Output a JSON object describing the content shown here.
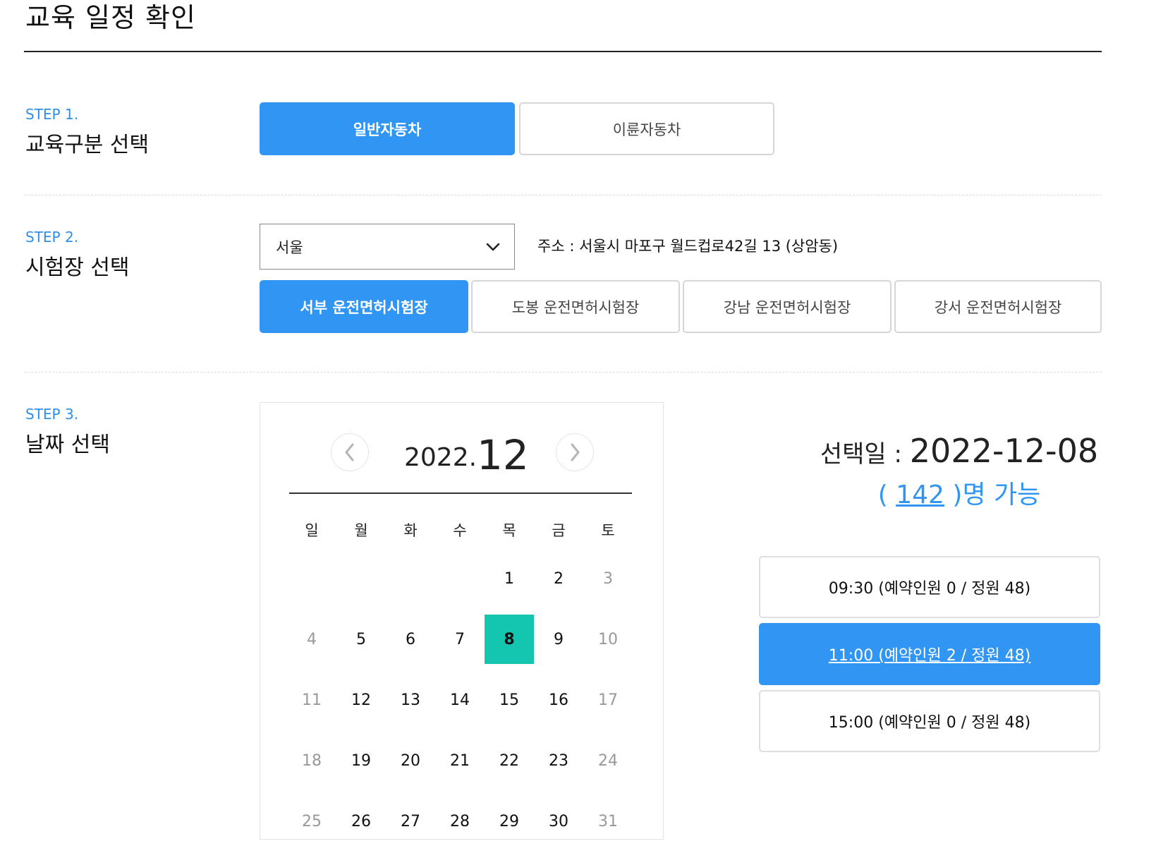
{
  "page": {
    "title": "교육 일정 확인"
  },
  "step1": {
    "label": "STEP 1.",
    "title": "교육구분 선택",
    "options": [
      "일반자동차",
      "이륜자동차"
    ],
    "selected_index": 0
  },
  "step2": {
    "label": "STEP 2.",
    "title": "시험장 선택",
    "region_select": {
      "value": "서울"
    },
    "address": "주소 : 서울시 마포구 월드컵로42길 13 (상암동)",
    "centers": [
      "서부 운전면허시험장",
      "도봉 운전면허시험장",
      "강남 운전면허시험장",
      "강서 운전면허시험장"
    ],
    "selected_index": 0
  },
  "step3": {
    "label": "STEP 3.",
    "title": "날짜 선택",
    "calendar": {
      "year": "2022.",
      "month": "12",
      "weekdays": [
        "일",
        "월",
        "화",
        "수",
        "목",
        "금",
        "토"
      ],
      "weeks": [
        [
          "",
          "",
          "",
          "",
          "1",
          "2",
          "3"
        ],
        [
          "4",
          "5",
          "6",
          "7",
          "8",
          "9",
          "10"
        ],
        [
          "11",
          "12",
          "13",
          "14",
          "15",
          "16",
          "17"
        ],
        [
          "18",
          "19",
          "20",
          "21",
          "22",
          "23",
          "24"
        ],
        [
          "25",
          "26",
          "27",
          "28",
          "29",
          "30",
          "31"
        ]
      ],
      "selected_day": "8"
    },
    "selected_date": {
      "label": "선택일 : ",
      "value": "2022-12-08"
    },
    "availability": {
      "open": "( ",
      "count": "142",
      "close": " )명 가능"
    },
    "time_slots": [
      {
        "text": "09:30 (예약인원 0 / 정원 48)",
        "active": false
      },
      {
        "text": "11:00 (예약인원 2 / 정원 48)",
        "active": true
      },
      {
        "text": "15:00 (예약인원 0 / 정원 48)",
        "active": false
      }
    ]
  },
  "colors": {
    "accent": "#3195f4",
    "selected_day": "#14c5b0",
    "step_label": "#2f8fe8"
  }
}
